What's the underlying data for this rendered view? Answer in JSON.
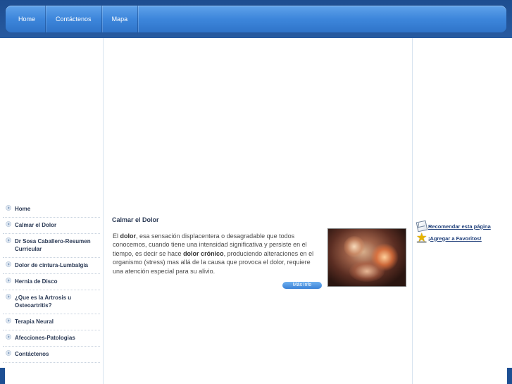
{
  "nav": {
    "items": [
      {
        "label": "Home"
      },
      {
        "label": "Contáctenos"
      },
      {
        "label": "Mapa"
      }
    ]
  },
  "menu": {
    "items": [
      {
        "label": "Home"
      },
      {
        "label": "Calmar el Dolor"
      },
      {
        "label": "Dr Sosa Caballero-Resumen Curricular"
      },
      {
        "label": "Dolor de cintura-Lumbalgia"
      },
      {
        "label": "Hernia de Disco"
      },
      {
        "label": "¿Que es la Artrosis u Osteoartritis?"
      },
      {
        "label": "Terapia Neural"
      },
      {
        "label": "Afecciones-Patologias"
      },
      {
        "label": "Contáctenos"
      }
    ]
  },
  "article": {
    "title": "Calmar el Dolor",
    "p1": "El ",
    "b1": "dolor",
    "p2": ", esa sensación displacentera o desagradable que todos conocemos, cuando tiene una intensidad significativa y persiste en el tiempo, es decir se hace ",
    "b2": "dolor crónico",
    "p3": ", produciendo alteraciones en el organismo (stress) mas allá de la causa que provoca el dolor, requiere una atención especial para su alivio.",
    "more_label": "Más info"
  },
  "sidebar": {
    "recommend_label": "Recomendar esta página",
    "favorites_label": "¡Agregar a Favoritos!"
  },
  "icons": [
    "envelope-icon",
    "star-icon",
    "arrow-bullet-icon"
  ],
  "colors": {
    "nav_blue": "#3d86db",
    "header_dark": "#1d4d90",
    "text_dark": "#2b3a55",
    "link": "#1f3f7a"
  }
}
